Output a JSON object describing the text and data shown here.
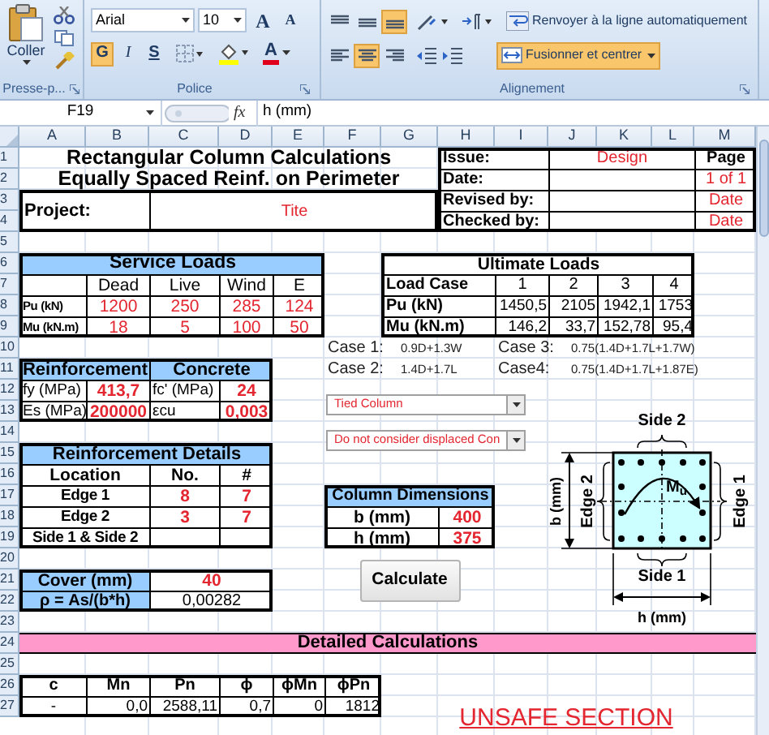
{
  "ribbon": {
    "clipboard": {
      "paste_label": "Coller",
      "group_label": "Presse-p..."
    },
    "font": {
      "font_name": "Arial",
      "font_size": "10",
      "grow_label": "A",
      "shrink_label": "A",
      "styles": [
        {
          "label": "G",
          "kind": "bold",
          "selected": true
        },
        {
          "label": "I",
          "kind": "italic",
          "selected": false
        },
        {
          "label": "S",
          "kind": "underline",
          "selected": false
        }
      ],
      "font_color_label": "A",
      "group_label": "Police"
    },
    "alignment": {
      "vertical": [
        {
          "kind": "top",
          "selected": false
        },
        {
          "kind": "middle",
          "selected": false
        },
        {
          "kind": "bottom",
          "selected": true
        }
      ],
      "horizontal": [
        {
          "kind": "left",
          "selected": false
        },
        {
          "kind": "center",
          "selected": true
        },
        {
          "kind": "right",
          "selected": false
        }
      ],
      "wrap_label": "Renvoyer à la ligne automatiquement",
      "merge_label": "Fusionner et centrer",
      "merge_selected": true,
      "group_label": "Alignement"
    }
  },
  "formula_bar": {
    "name_box": "F19",
    "fx": "fx",
    "formula": "h (mm)"
  },
  "columns": [
    "A",
    "B",
    "C",
    "D",
    "E",
    "F",
    "G",
    "H",
    "I",
    "J",
    "K",
    "L",
    "M"
  ],
  "rows": [
    "1",
    "2",
    "3",
    "4",
    "5",
    "6",
    "7",
    "8",
    "9",
    "10",
    "11",
    "12",
    "13",
    "14",
    "15",
    "16",
    "17",
    "18",
    "19",
    "20",
    "21",
    "22",
    "23",
    "24",
    "25",
    "26",
    "27"
  ],
  "sheet": {
    "title": [
      "Rectangular Column Calculations",
      "Equally Spaced Reinf. on Perimeter"
    ],
    "issue_box": [
      {
        "label": "Issue:",
        "value": "Design",
        "page": "Page"
      },
      {
        "label": "Date:",
        "page": "1 of 1"
      },
      {
        "label": "Revised by:",
        "page": "Date"
      },
      {
        "label": "Checked by:",
        "page": "Date"
      }
    ],
    "project": {
      "label": "Project:",
      "value": "Tite"
    },
    "service_loads": {
      "title": "Service Loads",
      "columns": [
        "Dead",
        "Live",
        "Wind",
        "E"
      ],
      "rows": [
        {
          "label": "Pu (kN)",
          "values": [
            "1200",
            "250",
            "285",
            "124"
          ]
        },
        {
          "label": "Mu (kN.m)",
          "values": [
            "18",
            "5",
            "100",
            "50"
          ]
        }
      ]
    },
    "ultimate_loads": {
      "title": "Ultimate Loads",
      "columns_label": "Load Case",
      "columns": [
        "1",
        "2",
        "3",
        "4"
      ],
      "rows": [
        {
          "label": "Pu (kN)",
          "values": [
            "1450,5",
            "2105",
            "1942,1",
            "1753"
          ]
        },
        {
          "label": "Mu (kN.m)",
          "values": [
            "146,2",
            "33,7",
            "152,78",
            "95,4"
          ]
        }
      ]
    },
    "load_cases": [
      {
        "label": "Case 1:",
        "formula": "0.9D+1.3W"
      },
      {
        "label": "Case 3:",
        "formula": "0.75(1.4D+1.7L+1.7W)"
      },
      {
        "label": "Case 2:",
        "formula": "1.4D+1.7L"
      },
      {
        "label": "Case4:",
        "formula": "0.75(1.4D+1.7L+1.87E)"
      }
    ],
    "reinforcement": {
      "title": "Reinforcement",
      "rows": [
        {
          "label": "fy (MPa)",
          "value": "413,7"
        },
        {
          "label": "Es (MPa)",
          "value": "200000"
        }
      ]
    },
    "concrete": {
      "title": "Concrete",
      "rows": [
        {
          "label": "fc' (MPa)",
          "value": "24"
        },
        {
          "label": "εcu",
          "value": "0,003"
        }
      ]
    },
    "dropdowns": [
      "Tied Column",
      "Do not consider displaced Con"
    ],
    "reinforcement_details": {
      "title": "Reinforcement Details",
      "columns": [
        "Location",
        "No.",
        "#"
      ],
      "rows": [
        {
          "location": "Edge 1",
          "number": "8",
          "size": "7"
        },
        {
          "location": "Edge 2",
          "number": "3",
          "size": "7"
        },
        {
          "location": "Side 1 & Side 2"
        }
      ]
    },
    "column_dimensions": {
      "title": "Column Dimensions",
      "rows": [
        {
          "label": "b (mm)",
          "value": "400"
        },
        {
          "label": "h (mm)",
          "value": "375"
        }
      ]
    },
    "cover": {
      "label": "Cover (mm)",
      "value": "40"
    },
    "ratio": {
      "label": "ρ = As/(b*h)",
      "value": "0,00282"
    },
    "calculate_button": "Calculate",
    "diagram": {
      "top": "Side 2",
      "bottom": "Side 1",
      "left": "Edge 2",
      "right": "Edge 1",
      "height_label": "b (mm)",
      "width_label": "h (mm)",
      "moment": "M$_{u}$"
    },
    "detailed_title": "Detailed Calculations",
    "detailed_table": {
      "columns": [
        "c",
        "Mn",
        "Pn",
        "ϕ",
        "ϕMn",
        "ϕPn"
      ],
      "rows": [
        [
          "-",
          "0,0",
          "2588,11",
          "0,7",
          "0",
          "1812"
        ]
      ]
    },
    "status": "UNSAFE SECTION"
  }
}
